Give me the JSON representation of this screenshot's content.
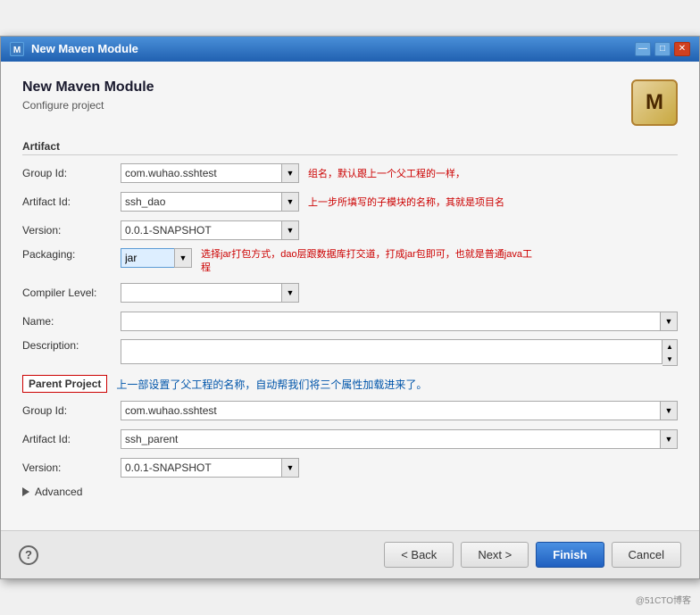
{
  "titleBar": {
    "title": "New Maven Module",
    "iconText": "M",
    "minBtn": "—",
    "maxBtn": "□",
    "closeBtn": "✕"
  },
  "header": {
    "title": "New Maven Module",
    "subtitle": "Configure project",
    "mavenIconText": "M"
  },
  "artifact": {
    "sectionLabel": "Artifact",
    "groupId": {
      "label": "Group Id:",
      "value": "com.wuhao.sshtest",
      "annotation": "组名，默认跟上一个父工程的一样，"
    },
    "artifactId": {
      "label": "Artifact Id:",
      "value": "ssh_dao",
      "annotation": "上一步所填写的子模块的名称，其就是项目名"
    },
    "version": {
      "label": "Version:",
      "value": "0.0.1-SNAPSHOT"
    },
    "packaging": {
      "label": "Packaging:",
      "value": "jar",
      "annotation": "选择jar打包方式，dao层跟数据库打交道，打成jar包即可，也就是普通java工程"
    },
    "compilerLevel": {
      "label": "Compiler Level:",
      "value": ""
    },
    "name": {
      "label": "Name:",
      "value": ""
    },
    "description": {
      "label": "Description:",
      "value": ""
    }
  },
  "parentProject": {
    "sectionLabel": "Parent Project",
    "annotation": "上一部设置了父工程的名称，自动帮我们将三个属性加载进来了。",
    "groupId": {
      "label": "Group Id:",
      "value": "com.wuhao.sshtest"
    },
    "artifactId": {
      "label": "Artifact Id:",
      "value": "ssh_parent"
    },
    "version": {
      "label": "Version:",
      "value": "0.0.1-SNAPSHOT"
    }
  },
  "advanced": {
    "label": "Advanced"
  },
  "footer": {
    "backBtn": "< Back",
    "nextBtn": "Next >",
    "finishBtn": "Finish",
    "cancelBtn": "Cancel"
  },
  "watermark": "@51CTO博客"
}
